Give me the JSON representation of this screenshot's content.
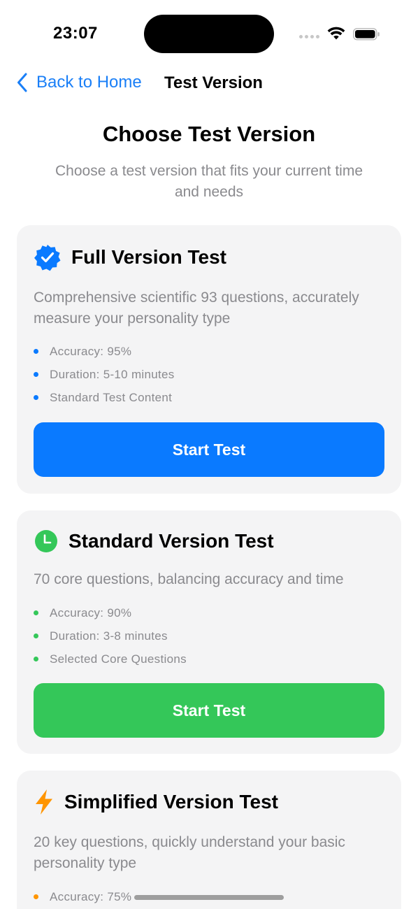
{
  "status_bar": {
    "time": "23:07"
  },
  "nav": {
    "back_label": "Back to Home",
    "title": "Test Version"
  },
  "header": {
    "title": "Choose Test Version",
    "subtitle": "Choose a test version that fits your current time and needs"
  },
  "colors": {
    "accent_blue": "#0a7aff",
    "accent_green": "#34c759",
    "accent_orange": "#ff9500",
    "card_bg": "#f4f4f5",
    "secondary_text": "#8a8a8e"
  },
  "cards": [
    {
      "icon": "verified-badge-icon",
      "title": "Full Version Test",
      "description": "Comprehensive scientific 93 questions, accurately measure your personality type",
      "features": [
        "Accuracy: 95%",
        "Duration: 5-10 minutes",
        "Standard Test Content"
      ],
      "button_label": "Start Test",
      "color": "#0a7aff"
    },
    {
      "icon": "clock-icon",
      "title": "Standard Version Test",
      "description": "70 core questions, balancing accuracy and time",
      "features": [
        "Accuracy: 90%",
        "Duration: 3-8 minutes",
        "Selected Core Questions"
      ],
      "button_label": "Start Test",
      "color": "#34c759"
    },
    {
      "icon": "lightning-bolt-icon",
      "title": "Simplified Version Test",
      "description": "20 key questions, quickly understand your basic personality type",
      "features": [
        "Accuracy: 75%"
      ],
      "color": "#ff9500"
    }
  ]
}
